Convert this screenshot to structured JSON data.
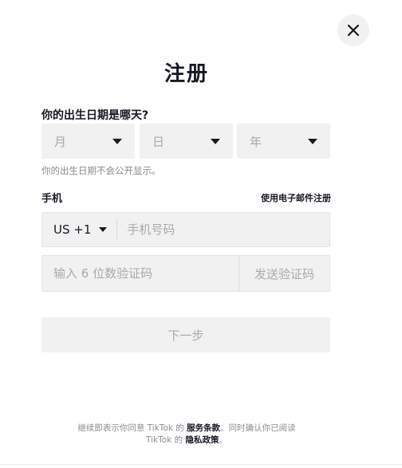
{
  "modal": {
    "close_icon": "close-icon",
    "title": "注册"
  },
  "birthday": {
    "label": "你的出生日期是哪天?",
    "month_placeholder": "月",
    "day_placeholder": "日",
    "year_placeholder": "年",
    "hint": "你的出生日期不会公开显示。"
  },
  "phone": {
    "label": "手机",
    "email_link": "使用电子邮件注册",
    "country_code": "US +1",
    "number_placeholder": "手机号码"
  },
  "verification": {
    "code_placeholder": "输入 6 位数验证码",
    "send_code_label": "发送验证码"
  },
  "next_label": "下一步",
  "footer": {
    "line1_prefix": "继续即表示你同意 TikTok 的 ",
    "terms_link": "服务条款",
    "line1_suffix": "。同时确认你已阅读",
    "line2_prefix": "TikTok 的 ",
    "privacy_link": "隐私政策",
    "line2_suffix": "。"
  },
  "colors": {
    "field_bg": "#f1f1f2",
    "text_primary": "#161823",
    "text_muted": "#a8a9ad"
  }
}
